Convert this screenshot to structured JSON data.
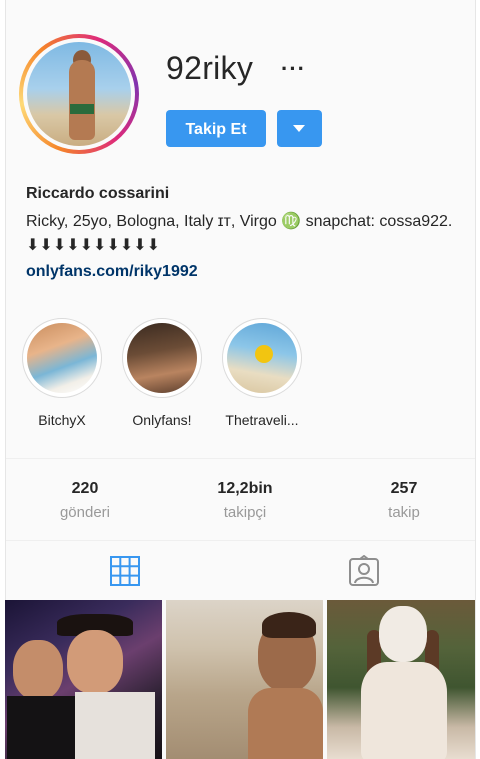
{
  "profile": {
    "username": "92riky",
    "more_label": "···",
    "follow_label": "Takip Et",
    "full_name": "Riccardo cossarini",
    "bio": "Ricky, 25yo, Bologna, Italy ɪᴛ, Virgo ♍ snapchat: cossa922. ⬇⬇⬇⬇⬇⬇⬇⬇⬇⬇",
    "link": "onlyfans.com/riky1992"
  },
  "highlights": [
    {
      "label": "BitchyX"
    },
    {
      "label": "Onlyfans!"
    },
    {
      "label": "Thetraveli..."
    }
  ],
  "stats": [
    {
      "value": "220",
      "label": "gönderi"
    },
    {
      "value": "12,2bin",
      "label": "takipçi"
    },
    {
      "value": "257",
      "label": "takip"
    }
  ],
  "tabs": [
    {
      "icon": "grid-icon",
      "active": true
    },
    {
      "icon": "tagged-icon",
      "active": false
    }
  ],
  "colors": {
    "accent": "#3897f0",
    "link": "#003569",
    "muted": "#999999",
    "tab_active": "#3897f0",
    "tab_inactive": "#8e8e8e"
  }
}
